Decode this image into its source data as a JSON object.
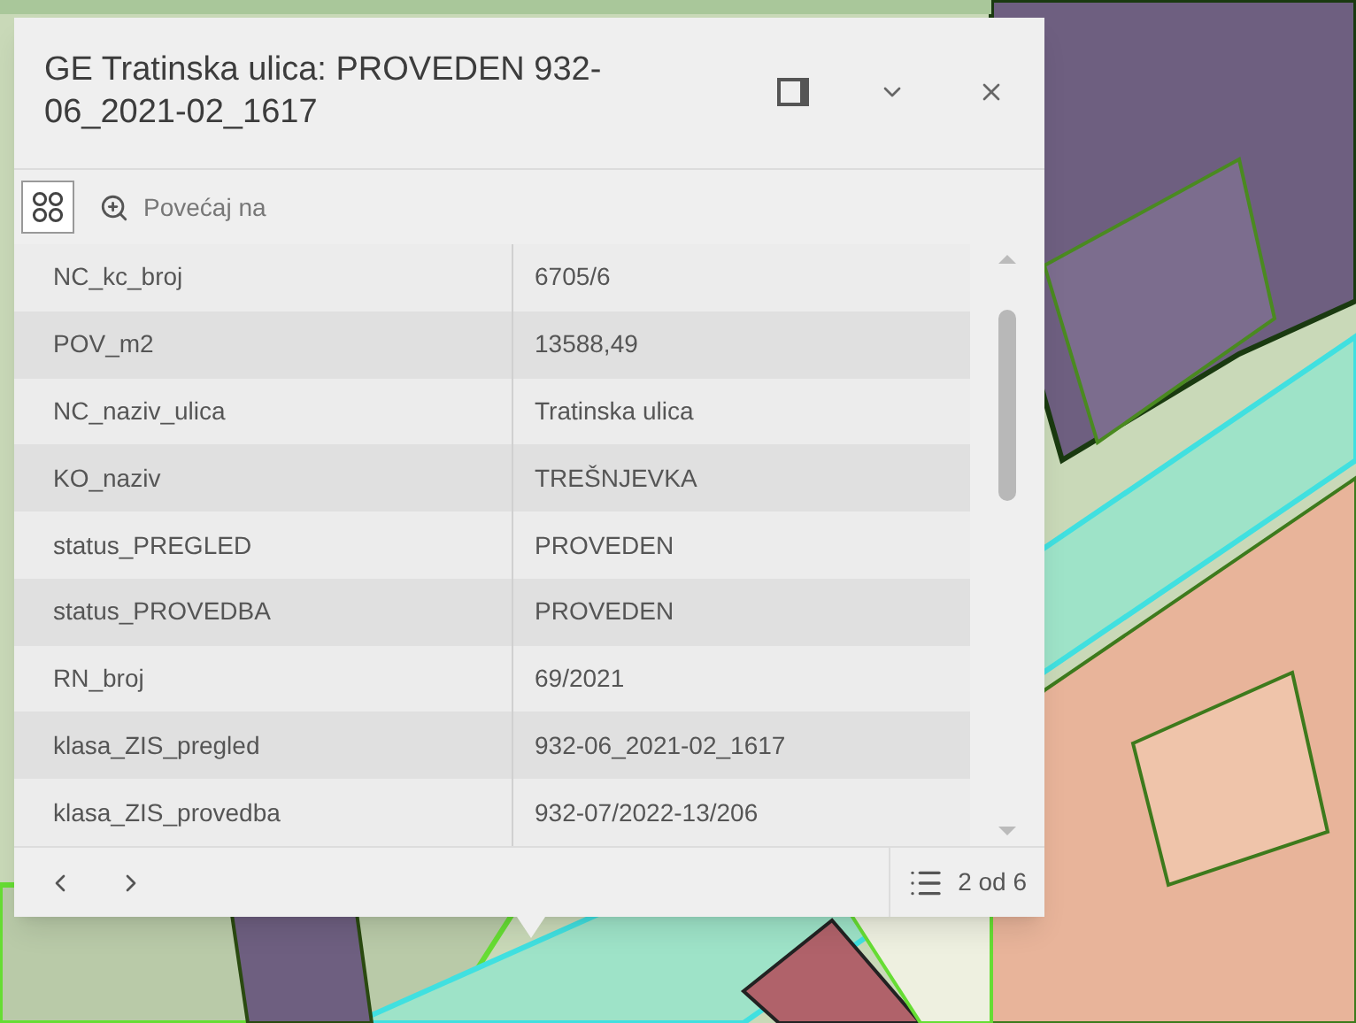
{
  "popup": {
    "title": "GE Tratinska ulica: PROVEDEN 932-06_2021-02_1617",
    "zoom_action": "Povećaj na",
    "rows": [
      {
        "field": "NC_kc_broj",
        "value": "6705/6"
      },
      {
        "field": "POV_m2",
        "value": "13588,49"
      },
      {
        "field": "NC_naziv_ulica",
        "value": "Tratinska ulica"
      },
      {
        "field": "KO_naziv",
        "value": "TREŠNJEVKA"
      },
      {
        "field": "status_PREGLED",
        "value": "PROVEDEN"
      },
      {
        "field": "status_PROVEDBA",
        "value": "PROVEDEN"
      },
      {
        "field": "RN_broj",
        "value": "69/2021"
      },
      {
        "field": "klasa_ZIS_pregled",
        "value": "932-06_2021-02_1617"
      },
      {
        "field": "klasa_ZIS_provedba",
        "value": "932-07/2022-13/206"
      }
    ],
    "pager": "2 od 6"
  }
}
